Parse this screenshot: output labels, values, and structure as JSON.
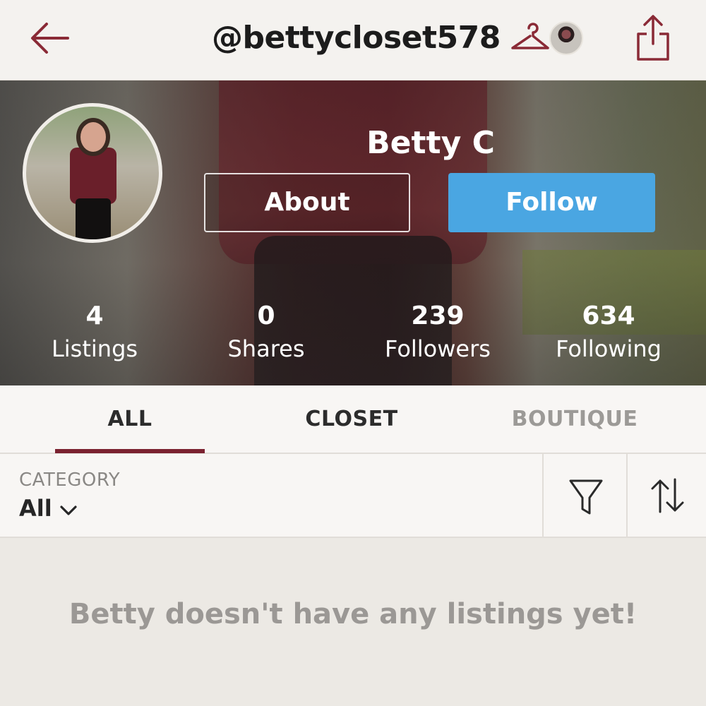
{
  "header": {
    "username": "@bettycloset578"
  },
  "icons": {
    "back": "back-arrow-icon",
    "closet": "hanger-icon",
    "share": "share-icon",
    "filter": "filter-icon",
    "sort": "sort-icon",
    "chevron": "chevron-down-icon"
  },
  "profile": {
    "name": "Betty C",
    "about_label": "About",
    "follow_label": "Follow"
  },
  "stats": [
    {
      "value": "4",
      "label": "Listings"
    },
    {
      "value": "0",
      "label": "Shares"
    },
    {
      "value": "239",
      "label": "Followers"
    },
    {
      "value": "634",
      "label": "Following"
    }
  ],
  "tabs": [
    {
      "label": "ALL",
      "active": true
    },
    {
      "label": "CLOSET",
      "active": false
    },
    {
      "label": "BOUTIQUE",
      "active": false
    }
  ],
  "filter": {
    "category_label": "CATEGORY",
    "category_value": "All"
  },
  "empty_message": "Betty doesn't have any listings yet!",
  "colors": {
    "accent": "#7b2230",
    "follow": "#4aa6e2",
    "icon": "#8a2a36"
  }
}
